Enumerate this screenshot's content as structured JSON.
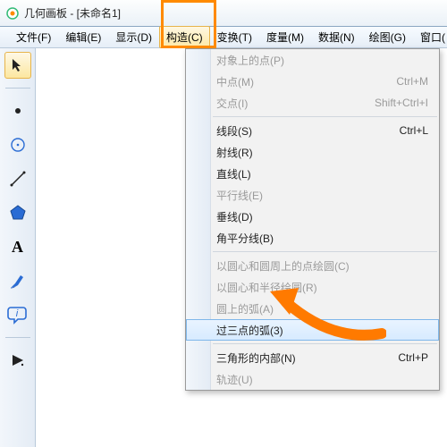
{
  "title": "几何画板 - [未命名1]",
  "menubar": {
    "items": [
      {
        "label": "文件(F)"
      },
      {
        "label": "编辑(E)"
      },
      {
        "label": "显示(D)"
      },
      {
        "label": "构造(C)",
        "active": true
      },
      {
        "label": "变换(T)"
      },
      {
        "label": "度量(M)"
      },
      {
        "label": "数据(N)"
      },
      {
        "label": "绘图(G)"
      },
      {
        "label": "窗口("
      }
    ]
  },
  "dropdown": {
    "items": [
      {
        "label": "对象上的点(P)",
        "disabled": true
      },
      {
        "label": "中点(M)",
        "disabled": true,
        "shortcut": "Ctrl+M"
      },
      {
        "label": "交点(I)",
        "disabled": true,
        "shortcut": "Shift+Ctrl+I"
      },
      {
        "sep": true
      },
      {
        "label": "线段(S)",
        "shortcut": "Ctrl+L"
      },
      {
        "label": "射线(R)"
      },
      {
        "label": "直线(L)"
      },
      {
        "label": "平行线(E)",
        "disabled": true
      },
      {
        "label": "垂线(D)"
      },
      {
        "label": "角平分线(B)"
      },
      {
        "sep": true
      },
      {
        "label": "以圆心和圆周上的点绘圆(C)",
        "disabled": true
      },
      {
        "label": "以圆心和半径绘圆(R)",
        "disabled": true
      },
      {
        "label": "圆上的弧(A)",
        "disabled": true
      },
      {
        "label": "过三点的弧(3)",
        "hover": true
      },
      {
        "sep": true
      },
      {
        "label": "三角形的内部(N)",
        "shortcut": "Ctrl+P"
      },
      {
        "label": "轨迹(U)",
        "disabled": true
      }
    ]
  },
  "tools": {
    "arrow": "arrow-tool",
    "point": "point-tool",
    "circle": "circle-tool",
    "line": "line-tool",
    "polygon": "polygon-tool",
    "text": "text-tool",
    "marker": "marker-tool",
    "info": "info-tool",
    "custom": "custom-tool"
  }
}
